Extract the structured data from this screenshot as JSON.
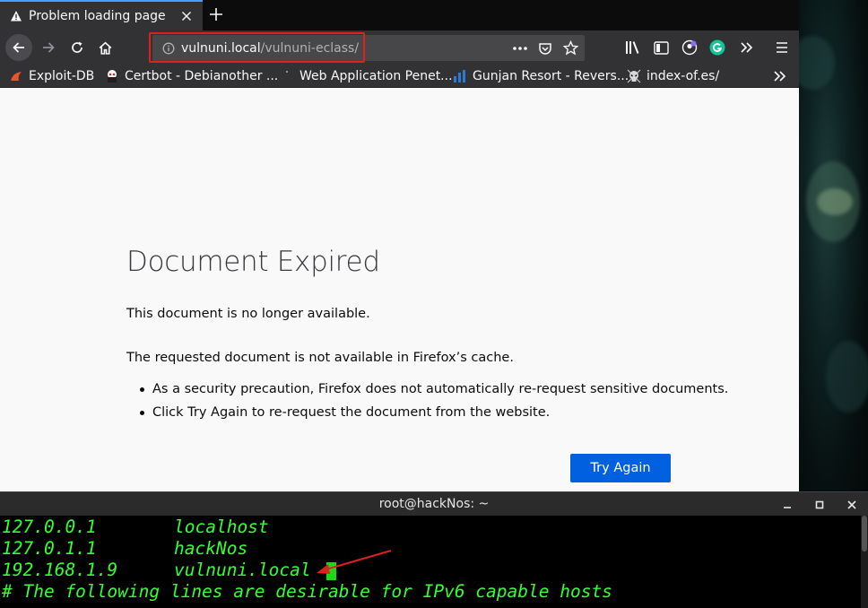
{
  "tab": {
    "title": "Problem loading page",
    "close_glyph": "✕",
    "new_tab_glyph": "+"
  },
  "url": {
    "host": "vulnuni.local",
    "path": "/vulnuni-eclass/"
  },
  "bookmarks": [
    {
      "label": "Exploit-DB",
      "icon": "exploit-db-icon"
    },
    {
      "label": "Certbot - Debianother ...",
      "icon": "certbot-icon"
    },
    {
      "label": "Web Application Penet...",
      "icon": "page-icon"
    },
    {
      "label": "Gunjan Resort - Revers...",
      "icon": "chart-icon"
    },
    {
      "label": "index-of.es/",
      "icon": "skull-icon"
    }
  ],
  "error": {
    "title": "Document Expired",
    "short_desc": "This document is no longer available.",
    "long_desc": "The requested document is not available in Firefox’s cache.",
    "bullets": [
      "As a security precaution, Firefox does not automatically re-request sensitive documents.",
      "Click Try Again to re-request the document from the website."
    ],
    "button": "Try Again"
  },
  "terminal": {
    "title": "root@hackNos: ~",
    "lines": [
      {
        "ip": "127.0.0.1",
        "host": "localhost"
      },
      {
        "ip": "127.0.1.1",
        "host": "hackNos"
      },
      {
        "ip": "192.168.1.9",
        "host": "vulnuni.local"
      }
    ],
    "comment": "# The following lines are desirable for IPv6 capable hosts"
  },
  "colors": {
    "accent_blue": "#0060df",
    "highlight_red": "#e0201b",
    "terminal_green": "#33ff33",
    "tab_indicator": "#45a1ff"
  }
}
